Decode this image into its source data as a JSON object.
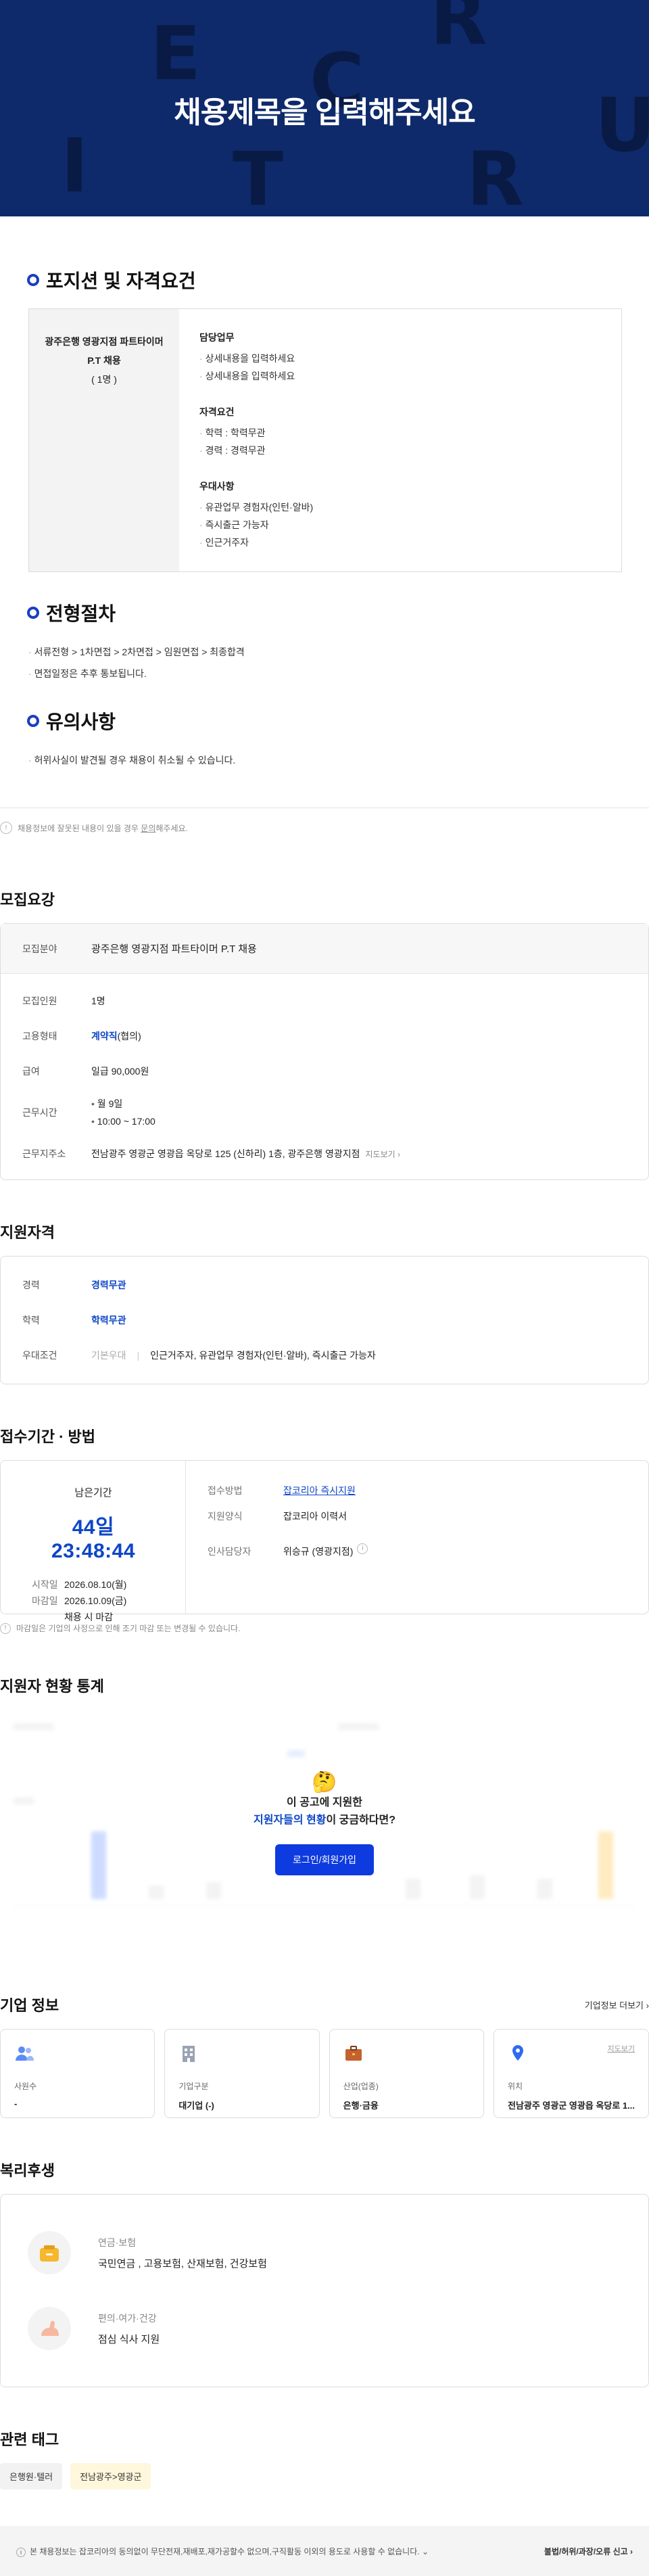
{
  "hero": {
    "title": "채용제목을 입력해주세요",
    "deco_letters": [
      "E",
      "R",
      "C",
      "U",
      "I",
      "T",
      "R"
    ]
  },
  "position": {
    "section_title": "포지션 및 자격요건",
    "job_name": "광주은행 영광지점 파트타이머 P.T 채용",
    "headcount": "( 1명 )",
    "duty_title": "담당업무",
    "duties": [
      "상세내용을 입력하세요",
      "상세내용을 입력하세요"
    ],
    "qual_title": "자격요건",
    "quals": [
      "학력 : 학력무관",
      "경력 : 경력무관"
    ],
    "pref_title": "우대사항",
    "prefs": [
      "유관업무 경험자(인턴·알바)",
      "즉시출근 가능자",
      "인근거주자"
    ]
  },
  "process": {
    "section_title": "전형절차",
    "items": [
      "서류전형 > 1차면접 > 2차면접 > 임원면접 > 최종합격",
      "면접일정은 추후 통보됩니다."
    ]
  },
  "caution": {
    "section_title": "유의사항",
    "items": [
      "허위사실이 발견될 경우 채용이 취소될 수 있습니다."
    ]
  },
  "report_note": {
    "prefix": "채용정보에 잘못된 내용이 있을 경우 ",
    "link": "문의",
    "suffix": "해주세요."
  },
  "recruit": {
    "title": "모집요강",
    "field_label": "모집분야",
    "field_value": "광주은행 영광지점 파트타이머 P.T 채용",
    "count_label": "모집인원",
    "count_value": "1명",
    "type_label": "고용형태",
    "type_value": "계약직",
    "type_suffix": "(협의)",
    "pay_label": "급여",
    "pay_value": "일급 90,000원",
    "time_label": "근무시간",
    "time_values": [
      "월 9일",
      "10:00 ~ 17:00"
    ],
    "addr_label": "근무지주소",
    "addr_value": "전남광주 영광군 영광읍 옥당로 125 (신하리) 1층, 광주은행 영광지점",
    "map_label": "지도보기"
  },
  "qualification": {
    "title": "지원자격",
    "career_label": "경력",
    "career_value": "경력무관",
    "edu_label": "학력",
    "edu_value": "학력무관",
    "pref_label": "우대조건",
    "pref_sub": "기본우대",
    "pref_value": "인근거주자, 유관업무 경험자(인턴·알바), 즉시출근 가능자"
  },
  "period": {
    "title": "접수기간 · 방법",
    "remain_label": "남은기간",
    "remain_value": "44일 23:48:44",
    "start_label": "시작일",
    "start_value": "2026.08.10(월)",
    "end_label": "마감일",
    "end_value": "2026.10.09(금)",
    "end_note": "채용 시 마감",
    "method_label": "접수방법",
    "method_value": "잡코리아 즉시지원",
    "form_label": "지원양식",
    "form_value": "잡코리아 이력서",
    "manager_label": "인사담당자",
    "manager_value": "위승규 (영광지점)",
    "note": "마감일은 기업의 사정으로 인해 조기 마감 또는 변경될 수 있습니다."
  },
  "stats": {
    "title": "지원자 현황 통계",
    "emoji": "🤔",
    "line1": "이 공고에 지원한",
    "line2_blue": "지원자들의 현황",
    "line2_rest": "이 궁금하다면?",
    "login_label": "로그인/회원가입"
  },
  "company": {
    "title": "기업 정보",
    "more_label": "기업정보 더보기",
    "cards": [
      {
        "key": "사원수",
        "value": "-",
        "icon": "people-icon"
      },
      {
        "key": "기업구분",
        "value": "대기업 (-)",
        "icon": "building-icon"
      },
      {
        "key": "산업(업종)",
        "value": "은행·금융",
        "icon": "briefcase-icon"
      },
      {
        "key": "위치",
        "value": "전남광주 영광군 영광읍 옥당로 1...",
        "icon": "location-icon",
        "link": "지도보기"
      }
    ]
  },
  "welfare": {
    "title": "복리후생",
    "items": [
      {
        "title": "연금·보험",
        "desc": "국민연금 , 고용보험, 산재보험, 건강보험",
        "icon": "piggybank-icon"
      },
      {
        "title": "편의·여가·건강",
        "desc": "점심 식사 지원",
        "icon": "arm-icon"
      }
    ]
  },
  "tags": {
    "title": "관련 태그",
    "items": [
      "은행원·텔러",
      "전남광주>영광군"
    ]
  },
  "footer": {
    "notice": "본 채용정보는 잡코리아의 동의없이 무단전재,재배포,재가공할수 없으며,구직활동 이외의 용도로 사용할 수 없습니다.",
    "report_label": "불법/허위/과장/오류 신고"
  },
  "colors": {
    "hero_bg": "#0e2a6b",
    "accent_blue": "#0e46c7",
    "button_blue": "#0e3be0"
  }
}
